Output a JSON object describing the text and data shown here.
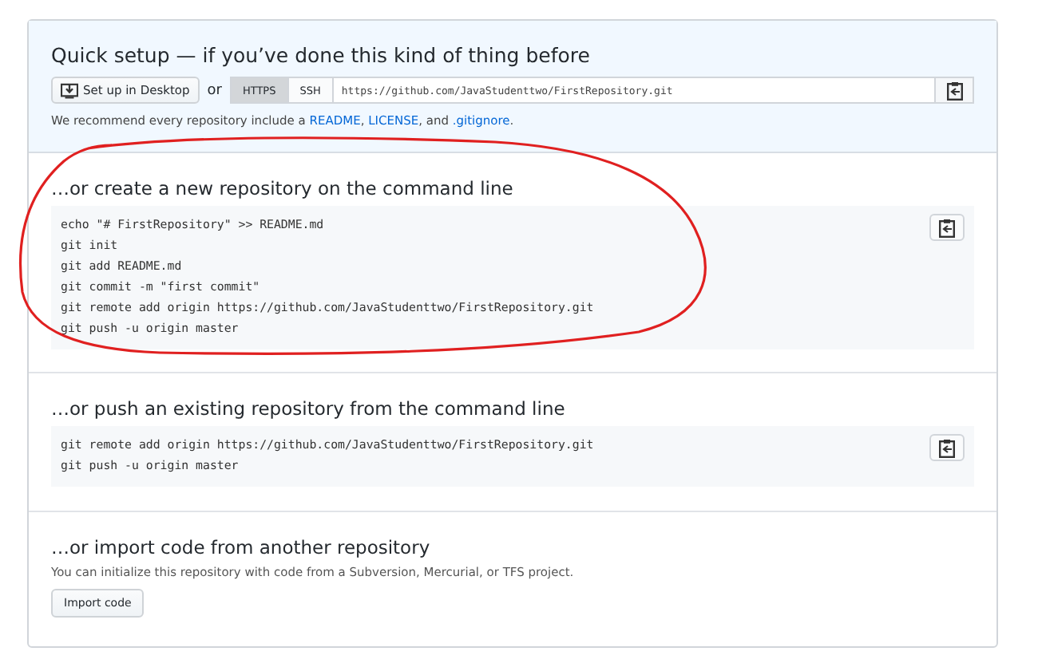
{
  "quick_setup": {
    "title": "Quick setup — if you’ve done this kind of thing before",
    "desktop_button": "Set up in Desktop",
    "or": "or",
    "protocols": [
      {
        "label": "HTTPS",
        "selected": true
      },
      {
        "label": "SSH",
        "selected": false
      }
    ],
    "clone_url": "https://github.com/JavaStudenttwo/FirstRepository.git",
    "recommend": [
      {
        "kind": "text",
        "text": "We recommend every repository include a "
      },
      {
        "kind": "link",
        "text": "README"
      },
      {
        "kind": "text",
        "text": ", "
      },
      {
        "kind": "link",
        "text": "LICENSE"
      },
      {
        "kind": "text",
        "text": ", and "
      },
      {
        "kind": "link",
        "text": ".gitignore"
      },
      {
        "kind": "text",
        "text": "."
      }
    ]
  },
  "sections": [
    {
      "kind": "code",
      "title": "…or create a new repository on the command line",
      "lines": [
        "echo \"# FirstRepository\" >> README.md",
        "git init",
        "git add README.md",
        "git commit -m \"first commit\"",
        "git remote add origin https://github.com/JavaStudenttwo/FirstRepository.git",
        "git push -u origin master"
      ],
      "annotated": true
    },
    {
      "kind": "code",
      "title": "…or push an existing repository from the command line",
      "lines": [
        "git remote add origin https://github.com/JavaStudenttwo/FirstRepository.git",
        "git push -u origin master"
      ],
      "annotated": false
    },
    {
      "kind": "import",
      "title": "…or import code from another repository",
      "text": "You can initialize this repository with code from a Subversion, Mercurial, or TFS project.",
      "button": "Import code"
    }
  ]
}
